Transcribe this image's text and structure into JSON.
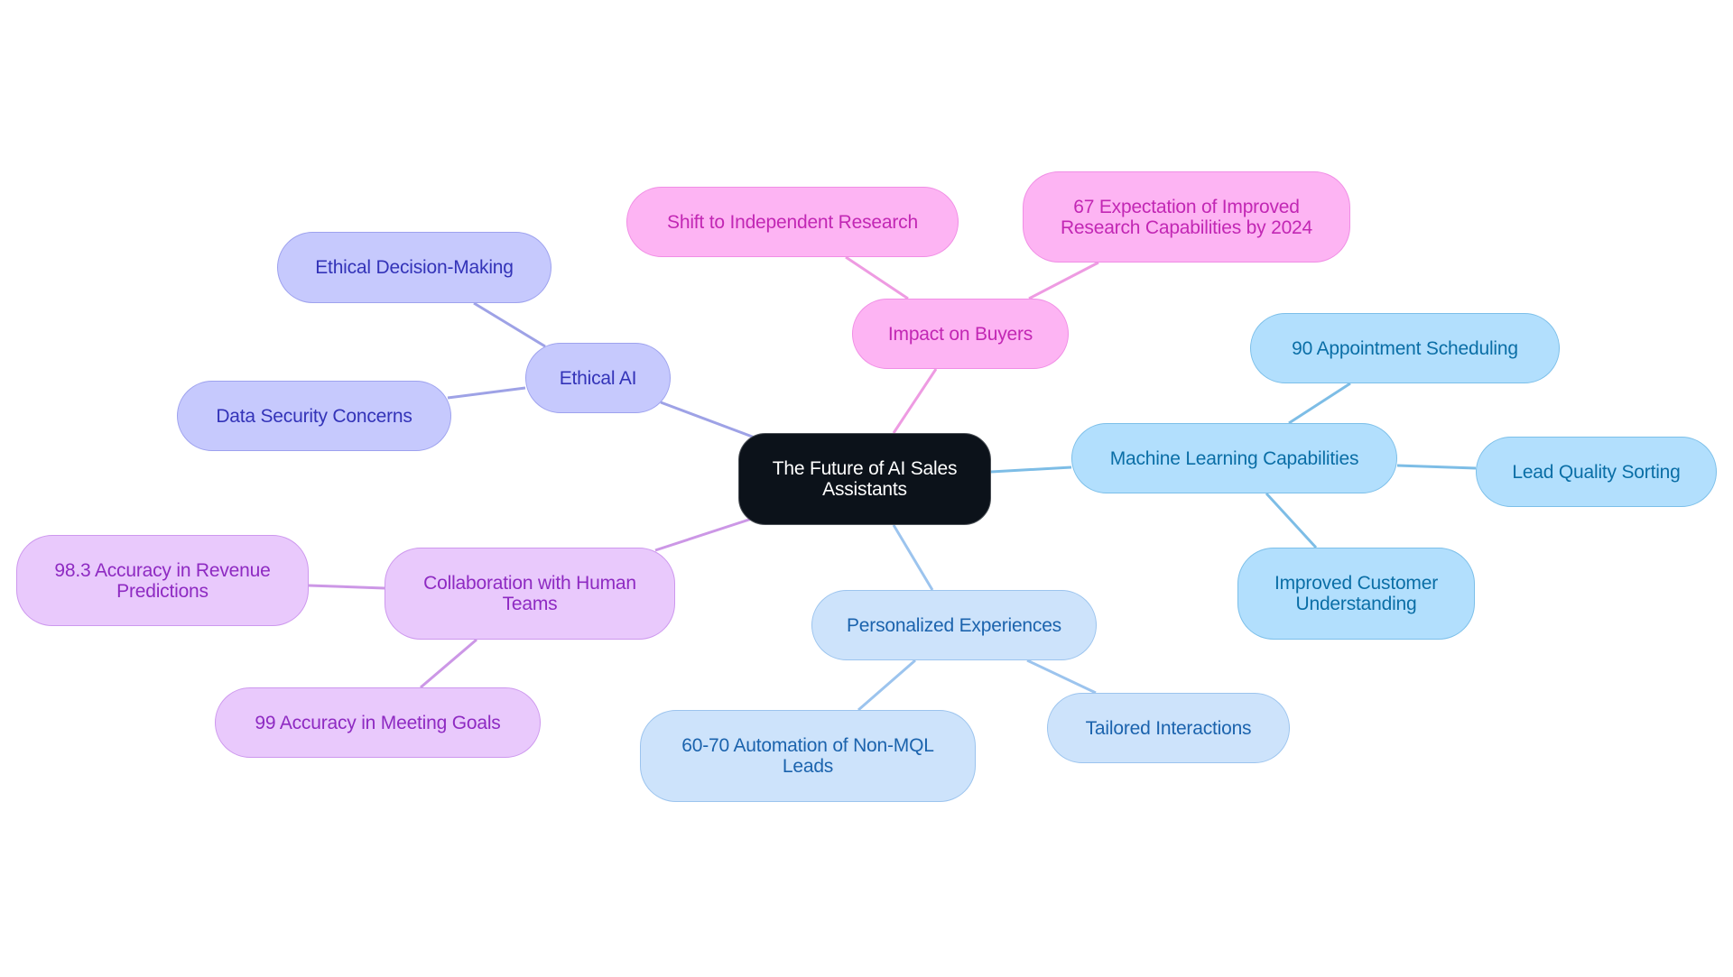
{
  "title": "The Future of AI Sales Assistants",
  "colors": {
    "root": "#0c121a",
    "impact_on_buyers": "#fdb4f3",
    "ethical_ai": "#c6c9fd",
    "machine_learning": "#b2dffd",
    "personalized": "#cde3fb",
    "collaboration": "#e9c9fc"
  },
  "nodes": {
    "root": {
      "label": "The Future of AI Sales Assistants"
    },
    "impact": {
      "label": "Impact on Buyers"
    },
    "shift": {
      "label": "Shift to Independent Research"
    },
    "expectation": {
      "label": "67 Expectation of Improved Research Capabilities by 2024"
    },
    "ethical": {
      "label": "Ethical AI"
    },
    "ethical_decision": {
      "label": "Ethical Decision-Making"
    },
    "data_security": {
      "label": "Data Security Concerns"
    },
    "ml": {
      "label": "Machine Learning Capabilities"
    },
    "appointment": {
      "label": "90 Appointment Scheduling"
    },
    "lead_quality": {
      "label": "Lead Quality Sorting"
    },
    "customer_understanding": {
      "label": "Improved Customer Understanding"
    },
    "personalized": {
      "label": "Personalized Experiences"
    },
    "automation": {
      "label": "60-70 Automation of Non-MQL Leads"
    },
    "tailored": {
      "label": "Tailored Interactions"
    },
    "collaboration": {
      "label": "Collaboration with Human Teams"
    },
    "revenue": {
      "label": "98.3 Accuracy in Revenue Predictions"
    },
    "meeting_goals": {
      "label": "99 Accuracy in Meeting Goals"
    }
  },
  "edges": [
    {
      "from": "root",
      "to": "impact"
    },
    {
      "from": "impact",
      "to": "shift"
    },
    {
      "from": "impact",
      "to": "expectation"
    },
    {
      "from": "root",
      "to": "ethical"
    },
    {
      "from": "ethical",
      "to": "ethical_decision"
    },
    {
      "from": "ethical",
      "to": "data_security"
    },
    {
      "from": "root",
      "to": "ml"
    },
    {
      "from": "ml",
      "to": "appointment"
    },
    {
      "from": "ml",
      "to": "lead_quality"
    },
    {
      "from": "ml",
      "to": "customer_understanding"
    },
    {
      "from": "root",
      "to": "personalized"
    },
    {
      "from": "personalized",
      "to": "automation"
    },
    {
      "from": "personalized",
      "to": "tailored"
    },
    {
      "from": "root",
      "to": "collaboration"
    },
    {
      "from": "collaboration",
      "to": "revenue"
    },
    {
      "from": "collaboration",
      "to": "meeting_goals"
    }
  ]
}
